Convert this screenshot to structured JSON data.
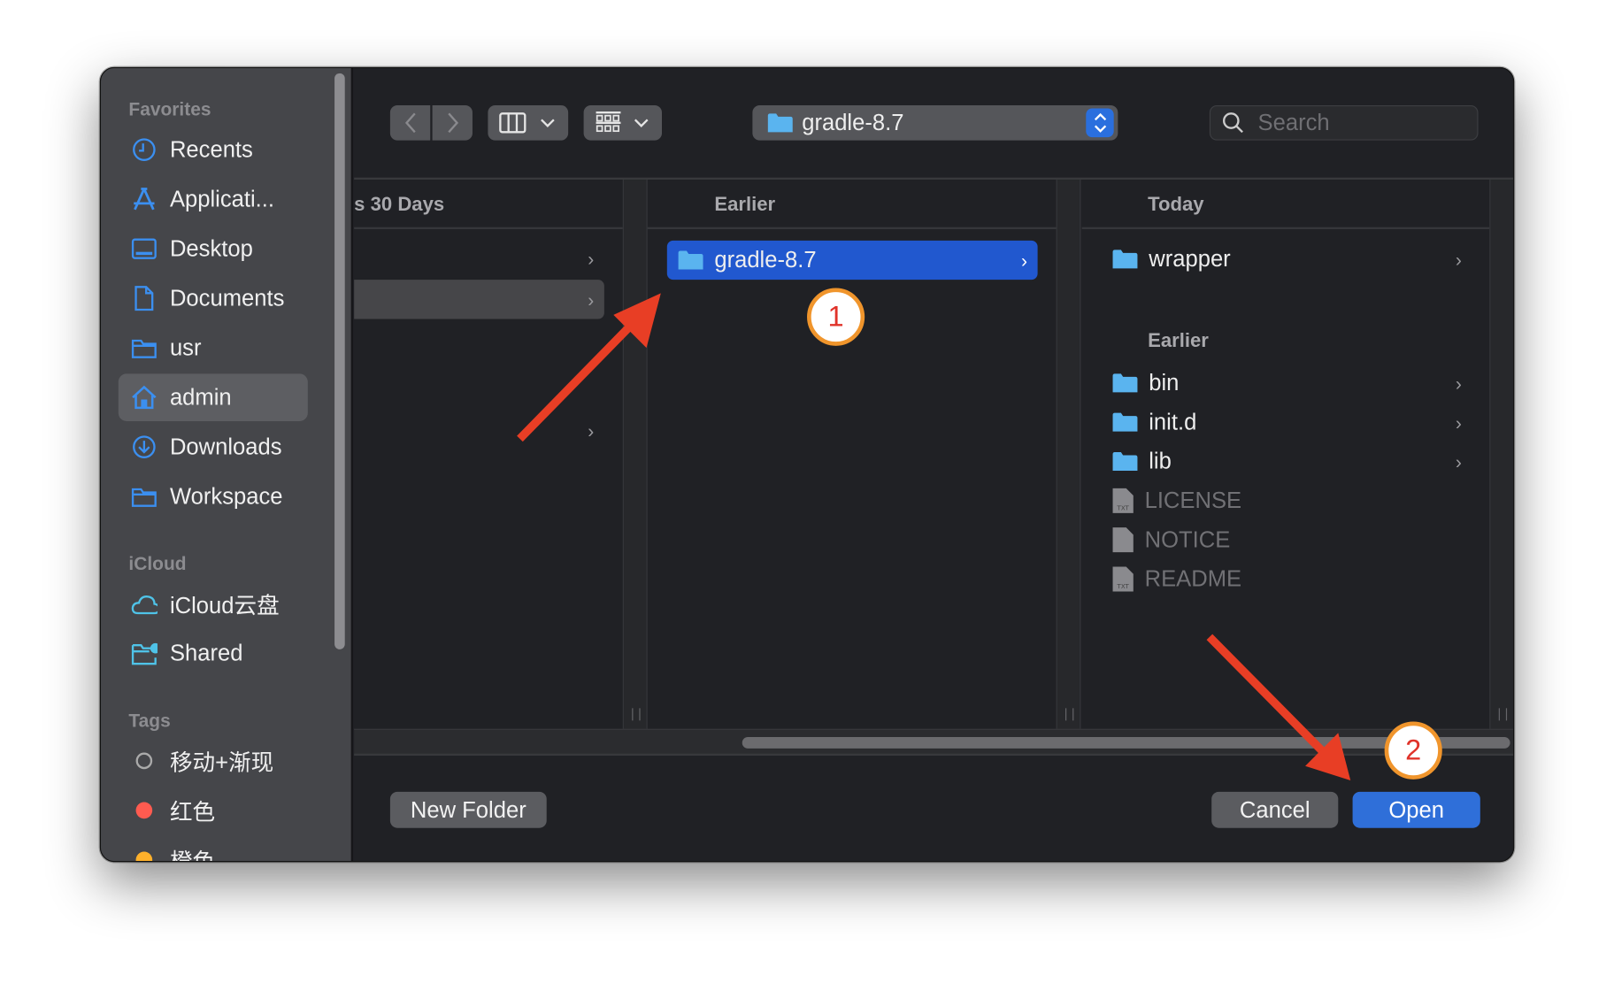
{
  "sidebar": {
    "favorites_label": "Favorites",
    "favorites": [
      {
        "label": "Recents",
        "icon": "clock-icon"
      },
      {
        "label": "Applicati...",
        "icon": "applications-icon"
      },
      {
        "label": "Desktop",
        "icon": "desktop-icon"
      },
      {
        "label": "Documents",
        "icon": "document-icon"
      },
      {
        "label": "usr",
        "icon": "folder-icon"
      },
      {
        "label": "admin",
        "icon": "home-icon",
        "selected": true
      },
      {
        "label": "Downloads",
        "icon": "download-icon"
      },
      {
        "label": "Workspace",
        "icon": "folder-icon"
      }
    ],
    "icloud_label": "iCloud",
    "icloud": [
      {
        "label": "iCloud云盘",
        "icon": "cloud-icon"
      },
      {
        "label": "Shared",
        "icon": "shared-folder-icon"
      }
    ],
    "tags_label": "Tags",
    "tags": [
      {
        "label": "移动+渐现",
        "color": "none"
      },
      {
        "label": "红色",
        "color": "#ff5b50"
      },
      {
        "label": "橙色",
        "color": "#ffb12b"
      }
    ]
  },
  "toolbar": {
    "path": "gradle-8.7",
    "search_placeholder": "Search"
  },
  "columns": [
    {
      "header": "s 30 Days"
    },
    {
      "header": "Earlier",
      "items": [
        {
          "name": "gradle-8.7",
          "selected": true
        }
      ]
    },
    {
      "header": "Today",
      "today_items": [
        {
          "name": "wrapper",
          "type": "folder"
        }
      ],
      "earlier_header": "Earlier",
      "earlier_items": [
        {
          "name": "bin",
          "type": "folder"
        },
        {
          "name": "init.d",
          "type": "folder"
        },
        {
          "name": "lib",
          "type": "folder"
        },
        {
          "name": "LICENSE",
          "type": "txt-file"
        },
        {
          "name": "NOTICE",
          "type": "file"
        },
        {
          "name": "README",
          "type": "txt-file"
        }
      ]
    }
  ],
  "footer": {
    "new_folder": "New Folder",
    "cancel": "Cancel",
    "open": "Open"
  },
  "annotations": {
    "step1": "1",
    "step2": "2"
  },
  "colors": {
    "accent": "#2f6fd9",
    "selection": "#2158cf",
    "folder": "#5ab4ef",
    "arrow": "#e83e25",
    "badge_ring": "#f0952c"
  }
}
